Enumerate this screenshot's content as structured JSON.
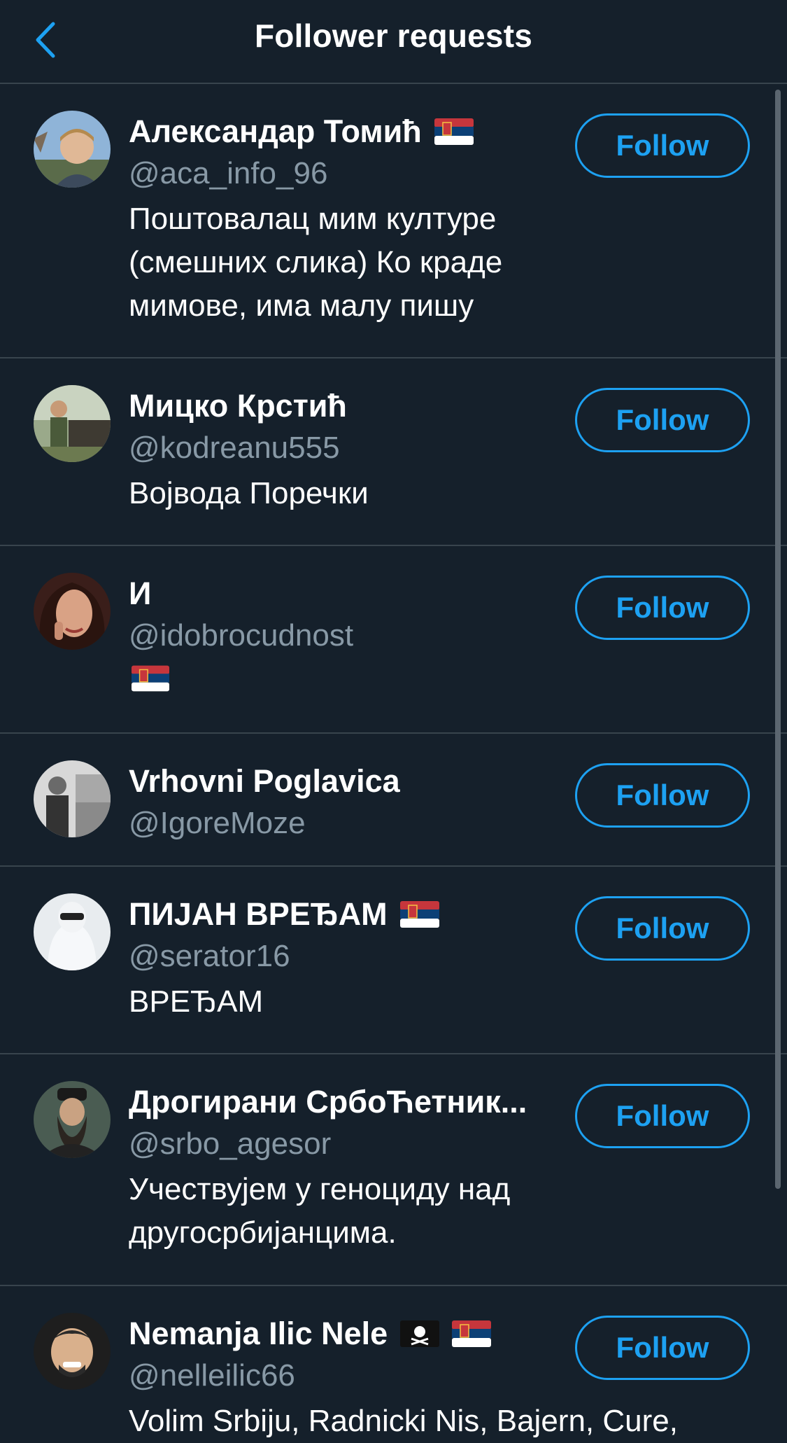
{
  "header": {
    "title": "Follower requests",
    "back_icon": "chevron-left-icon"
  },
  "colors": {
    "background": "#15202b",
    "accent": "#1da1f2",
    "secondary_text": "#8899a6",
    "divider": "#38444d"
  },
  "requests": [
    {
      "name": "Александар Томић",
      "name_flags": [
        "serbia-flag"
      ],
      "handle": "@aca_info_96",
      "bio": "Поштовалац мим културе (смешних слика) Ко краде мимове, има малу пишу",
      "bio_flag": false,
      "follow_label": "Follow"
    },
    {
      "name": "Мицко Крстић",
      "name_flags": [],
      "handle": "@kodreanu555",
      "bio": "Војвода Поречки",
      "bio_flag": false,
      "follow_label": "Follow"
    },
    {
      "name": "И",
      "name_flags": [],
      "handle": "@idobrocudnost",
      "bio": "",
      "bio_flag": true,
      "follow_label": "Follow"
    },
    {
      "name": "Vrhovni Poglavica",
      "name_flags": [],
      "handle": "@IgoreMoze",
      "bio": "",
      "bio_flag": false,
      "follow_label": "Follow"
    },
    {
      "name": "ПИЈАН ВРЕЂАМ",
      "name_flags": [
        "serbia-flag"
      ],
      "handle": "@serator16",
      "bio": "ВРЕЂАМ",
      "bio_flag": false,
      "follow_label": "Follow"
    },
    {
      "name": "Дрогирани СрбоЋетник...",
      "name_flags": [],
      "handle": "@srbo_agesor",
      "bio": "Учествујем у геноциду над другосрбијанцима.",
      "bio_flag": false,
      "follow_label": "Follow"
    },
    {
      "name": "Nemanja Ilic Nele",
      "name_flags": [
        "pirate-flag",
        "serbia-flag"
      ],
      "handle": "@nelleilic66",
      "bio": "Volim Srbiju, Radnicki Nis, Bajern, Cure,",
      "bio_flag": false,
      "follow_label": "Follow"
    }
  ]
}
